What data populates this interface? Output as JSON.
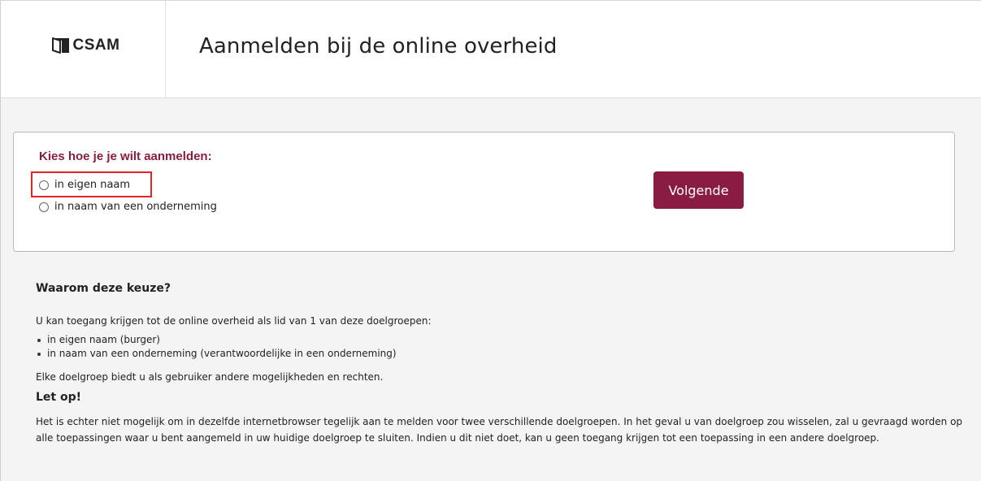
{
  "header": {
    "logo_text": "CSAM",
    "title": "Aanmelden bij de online overheid"
  },
  "login_choice": {
    "question": "Kies hoe je je wilt aanmelden:",
    "options": [
      {
        "label": "in eigen naam",
        "selected": false,
        "highlighted": true
      },
      {
        "label": "in naam van een onderneming",
        "selected": false,
        "highlighted": false
      }
    ],
    "next_label": "Volgende"
  },
  "info": {
    "heading": "Waarom deze keuze?",
    "intro": "U kan toegang krijgen tot de online overheid als lid van 1 van deze doelgroepen:",
    "groups": [
      "in eigen naam (burger)",
      "in naam van een onderneming (verantwoordelijke in een onderneming)"
    ],
    "rights": "Elke doelgroep biedt u als gebruiker andere mogelijkheden en rechten.",
    "warning_heading": "Let op!",
    "warning_text": "Het is echter niet mogelijk om in dezelfde internetbrowser tegelijk aan te melden voor twee verschillende doelgroepen. In het geval u van doelgroep zou wisselen, zal u gevraagd worden op alle toepassingen waar u bent aangemeld in uw huidige doelgroep te sluiten. Indien u dit niet doet, kan u geen toegang krijgen tot een toepassing in een andere doelgroep."
  },
  "colors": {
    "accent": "#8a1c44",
    "highlight": "#e0262b",
    "background": "#f4f4f4",
    "card_border": "#b9b9b9"
  },
  "icons": {
    "logo": "csam-door-icon",
    "radio": "radio-unchecked-icon"
  }
}
